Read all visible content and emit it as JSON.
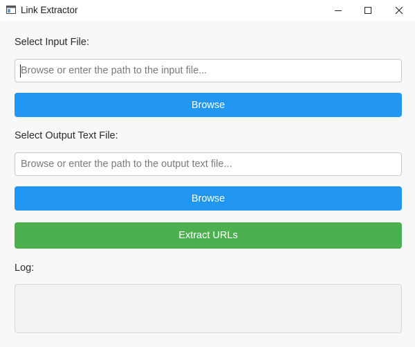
{
  "window": {
    "title": "Link Extractor",
    "icons": {
      "app": "window-app-icon",
      "minimize": "minimize-icon",
      "maximize": "maximize-icon",
      "close": "close-icon"
    }
  },
  "input_section": {
    "label": "Select Input File:",
    "placeholder": "Browse or enter the path to the input file...",
    "value": "",
    "browse_label": "Browse"
  },
  "output_section": {
    "label": "Select Output Text File:",
    "placeholder": "Browse or enter the path to the output text file...",
    "value": "",
    "browse_label": "Browse"
  },
  "extract_button": {
    "label": "Extract URLs"
  },
  "log": {
    "label": "Log:",
    "content": ""
  },
  "colors": {
    "browse_button": "#2196f3",
    "extract_button": "#4caf50",
    "background": "#f8f8f8"
  }
}
